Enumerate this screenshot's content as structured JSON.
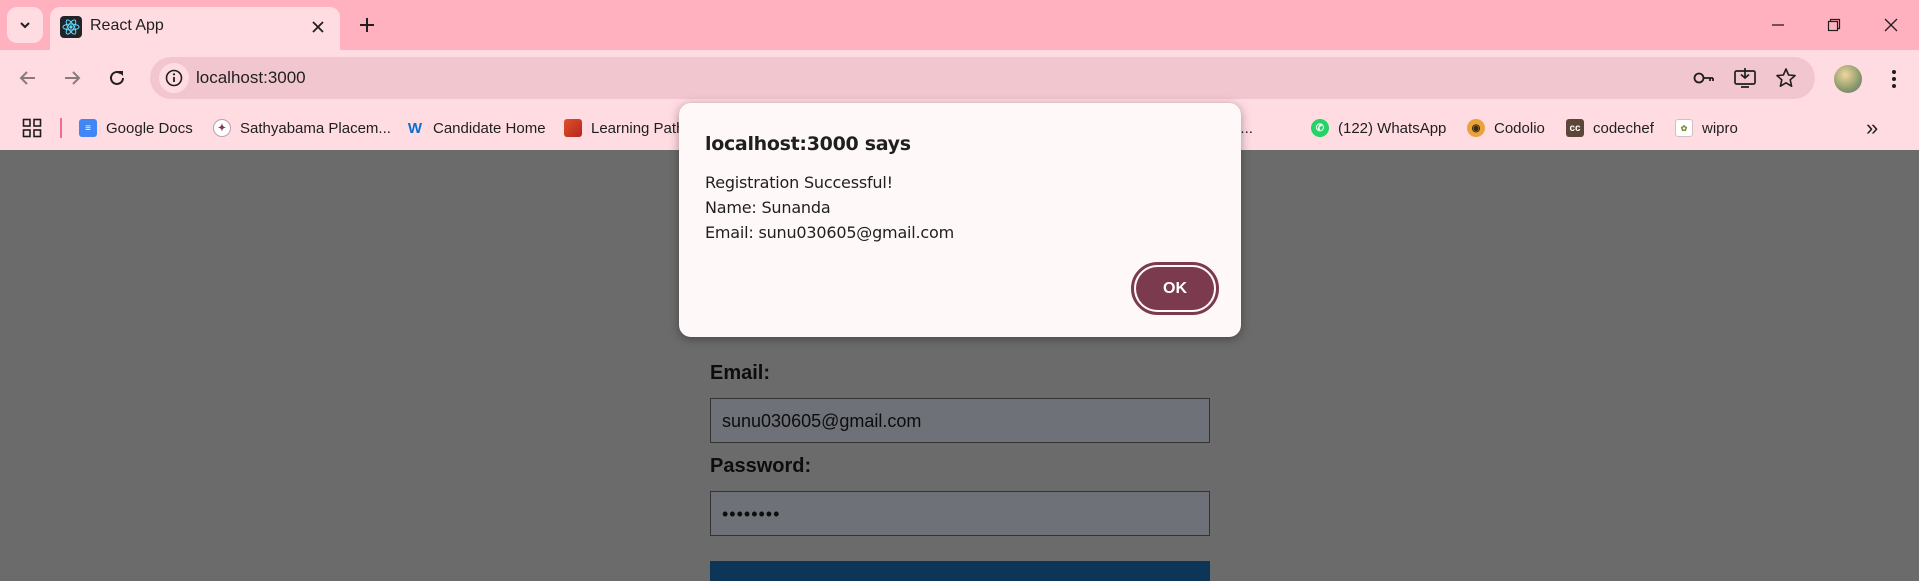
{
  "browser": {
    "tab": {
      "title": "React App"
    },
    "address": {
      "url": "localhost:3000"
    },
    "bookmarks": [
      {
        "label": "Google Docs",
        "icon": "google-docs-icon"
      },
      {
        "label": "Sathyabama Placem...",
        "icon": "sathyabama-icon"
      },
      {
        "label": "Candidate Home",
        "icon": "workday-icon"
      },
      {
        "label": "Learning Path",
        "icon": "learning-path-icon"
      },
      {
        "label": "io Te...",
        "icon": ""
      },
      {
        "label": "(122) WhatsApp",
        "icon": "whatsapp-icon"
      },
      {
        "label": "Codolio",
        "icon": "codolio-icon"
      },
      {
        "label": "codechef",
        "icon": "codechef-icon"
      },
      {
        "label": "wipro",
        "icon": "wipro-icon"
      }
    ],
    "overflow": "»"
  },
  "form": {
    "email_label": "Email:",
    "email_value": "sunu030605@gmail.com",
    "password_label": "Password:",
    "password_value": "••••••••"
  },
  "dialog": {
    "title": "localhost:3000 says",
    "line1": "Registration Successful!",
    "line2": "Name: Sunanda",
    "line3": "Email: sunu030605@gmail.com",
    "ok_label": "OK"
  },
  "colors": {
    "titlebar": "#ffb1bf",
    "toolbar": "#ffdbe2",
    "dialog_button": "#7b3a4d",
    "overlay": "#6b6b6b"
  }
}
